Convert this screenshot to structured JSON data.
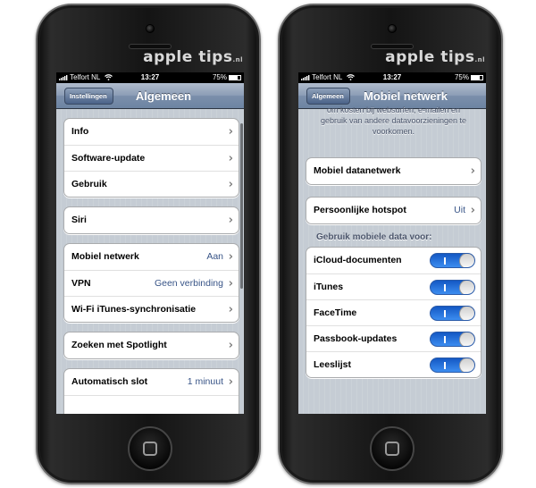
{
  "watermark": {
    "text": "apple tips",
    "suffix": ".nl"
  },
  "left_phone": {
    "status": {
      "carrier": "Telfort NL",
      "time": "13:27",
      "battery": "75%"
    },
    "nav": {
      "back_label": "Instellingen",
      "title": "Algemeen"
    },
    "groups": [
      [
        {
          "label": "Info",
          "value": ""
        },
        {
          "label": "Software-update",
          "value": ""
        },
        {
          "label": "Gebruik",
          "value": ""
        }
      ],
      [
        {
          "label": "Siri",
          "value": ""
        }
      ],
      [
        {
          "label": "Mobiel netwerk",
          "value": "Aan"
        },
        {
          "label": "VPN",
          "value": "Geen verbinding"
        },
        {
          "label": "Wi-Fi iTunes-synchronisatie",
          "value": ""
        }
      ],
      [
        {
          "label": "Zoeken met Spotlight",
          "value": ""
        }
      ],
      [
        {
          "label": "Automatisch slot",
          "value": "1 minuut"
        }
      ]
    ]
  },
  "right_phone": {
    "status": {
      "carrier": "Telfort NL",
      "time": "13:27",
      "battery": "75%"
    },
    "nav": {
      "back_label": "Algemeen",
      "title": "Mobiel netwerk"
    },
    "description": {
      "line1": "om kosten bij websurfen, e-mailen en",
      "line2": "gebruik van andere datavoorzieningen te",
      "line3": "voorkomen."
    },
    "rows": {
      "mobile_data_network": {
        "label": "Mobiel datanetwerk",
        "value": ""
      },
      "personal_hotspot": {
        "label": "Persoonlijke hotspot",
        "value": "Uit"
      }
    },
    "section_header": "Gebruik mobiele data voor:",
    "toggles": [
      {
        "label": "iCloud-documenten",
        "on": true
      },
      {
        "label": "iTunes",
        "on": true
      },
      {
        "label": "FaceTime",
        "on": true
      },
      {
        "label": "Passbook-updates",
        "on": true
      },
      {
        "label": "Leeslijst",
        "on": true
      }
    ],
    "colors": {
      "toggle_on": "#1e6fdc",
      "nav_bar": "#7b8fab",
      "value_text": "#385487"
    }
  }
}
